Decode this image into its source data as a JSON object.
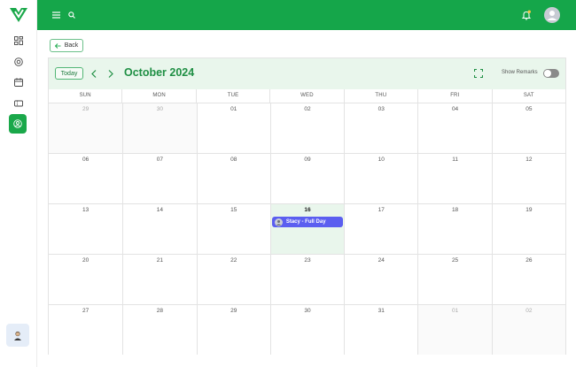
{
  "sidebar": {
    "logo": "checkmark-logo",
    "items": [
      {
        "name": "dashboard-icon"
      },
      {
        "name": "target-icon"
      },
      {
        "name": "calendar-icon"
      },
      {
        "name": "ticket-icon"
      },
      {
        "name": "user-circle-icon",
        "active": true
      }
    ],
    "accent": "#1aa84a"
  },
  "topbar": {
    "color": "#15a64a",
    "menu_icon": "menu-icon",
    "search_icon": "search-icon",
    "notification_icon": "bell-icon",
    "profile_icon": "avatar-icon"
  },
  "back": {
    "label": "Back"
  },
  "calendar": {
    "today_label": "Today",
    "month": "October 2024",
    "show_remarks_label": "Show Remarks",
    "show_remarks_on": false,
    "weekdays": [
      "SUN",
      "MON",
      "TUE",
      "WED",
      "THU",
      "FRI",
      "SAT"
    ],
    "days": [
      {
        "n": "29",
        "other": true
      },
      {
        "n": "30",
        "other": true
      },
      {
        "n": "01"
      },
      {
        "n": "02"
      },
      {
        "n": "03"
      },
      {
        "n": "04"
      },
      {
        "n": "05"
      },
      {
        "n": "06"
      },
      {
        "n": "07"
      },
      {
        "n": "08"
      },
      {
        "n": "09"
      },
      {
        "n": "10"
      },
      {
        "n": "11"
      },
      {
        "n": "12"
      },
      {
        "n": "13"
      },
      {
        "n": "14"
      },
      {
        "n": "15"
      },
      {
        "n": "16",
        "today": true
      },
      {
        "n": "17"
      },
      {
        "n": "18"
      },
      {
        "n": "19"
      },
      {
        "n": "20"
      },
      {
        "n": "21"
      },
      {
        "n": "22"
      },
      {
        "n": "23"
      },
      {
        "n": "24"
      },
      {
        "n": "25"
      },
      {
        "n": "26"
      },
      {
        "n": "27"
      },
      {
        "n": "28"
      },
      {
        "n": "29"
      },
      {
        "n": "30"
      },
      {
        "n": "31"
      },
      {
        "n": "01",
        "other": true
      },
      {
        "n": "02",
        "other": true
      }
    ],
    "events": [
      {
        "day_index": 17,
        "title": "Stacy - Full Day",
        "color": "#5b5ef0"
      }
    ]
  }
}
